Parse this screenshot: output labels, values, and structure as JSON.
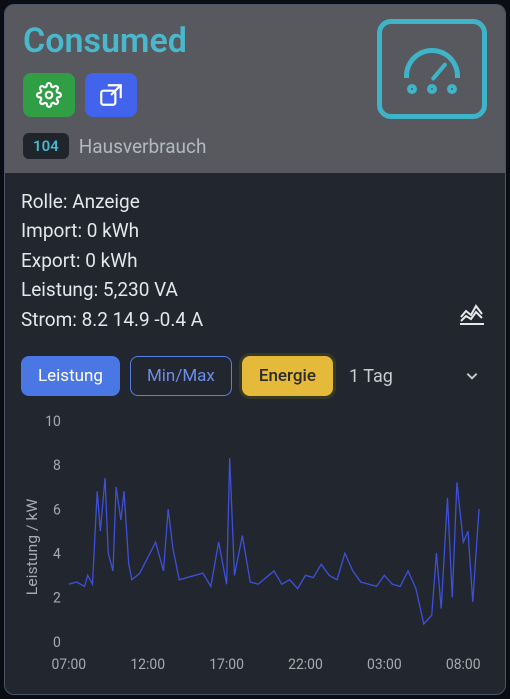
{
  "header": {
    "title": "Consumed",
    "device_id": "104",
    "device_name": "Hausverbrauch"
  },
  "info": {
    "rolle_label": "Rolle",
    "rolle_value": "Anzeige",
    "import_label": "Import",
    "import_value": "0 kWh",
    "export_label": "Export",
    "export_value": "0 kWh",
    "leistung_label": "Leistung",
    "leistung_value": "5,230 VA",
    "strom_label": "Strom",
    "strom_value": "8.2 14.9 -0.4 A"
  },
  "controls": {
    "leistung": "Leistung",
    "minmax": "Min/Max",
    "energie": "Energie",
    "range": "1 Tag"
  },
  "chart_data": {
    "type": "line",
    "title": "",
    "xlabel": "",
    "ylabel": "Leistung / kW",
    "ylim": [
      0,
      10
    ],
    "yticks": [
      0,
      2,
      4,
      6,
      8,
      10
    ],
    "xticks": [
      "07:00",
      "12:00",
      "17:00",
      "22:00",
      "03:00",
      "08:00"
    ],
    "x": [
      7.0,
      7.5,
      8.0,
      8.2,
      8.5,
      8.8,
      9.0,
      9.3,
      9.5,
      9.8,
      10.0,
      10.3,
      10.5,
      10.8,
      11.0,
      11.5,
      12.0,
      12.5,
      13.0,
      13.3,
      13.6,
      14.0,
      14.5,
      15.0,
      15.5,
      16.0,
      16.5,
      17.0,
      17.2,
      17.5,
      18.0,
      18.5,
      19.0,
      19.5,
      20.0,
      20.5,
      21.0,
      21.5,
      22.0,
      22.5,
      23.0,
      23.5,
      24.0,
      24.5,
      25.0,
      25.5,
      26.0,
      26.5,
      27.0,
      27.5,
      28.0,
      28.5,
      29.0,
      29.5,
      30.0,
      30.3,
      30.6,
      31.0,
      31.3,
      31.6,
      32.0,
      32.3,
      32.6,
      33.0
    ],
    "values": [
      2.6,
      2.7,
      2.5,
      3.0,
      2.6,
      6.8,
      5.0,
      7.4,
      4.0,
      3.2,
      7.0,
      5.5,
      6.8,
      3.5,
      2.8,
      3.1,
      3.8,
      4.5,
      3.2,
      6.0,
      4.2,
      2.8,
      2.9,
      3.0,
      3.1,
      2.5,
      4.5,
      2.6,
      8.3,
      3.0,
      4.8,
      2.7,
      2.6,
      2.9,
      3.2,
      2.6,
      2.8,
      2.4,
      3.0,
      2.9,
      3.5,
      3.0,
      2.8,
      4.0,
      3.2,
      2.7,
      2.6,
      2.5,
      3.0,
      2.6,
      2.5,
      3.2,
      2.4,
      0.8,
      1.2,
      4.0,
      1.5,
      6.5,
      2.0,
      7.2,
      4.5,
      5.0,
      1.8,
      6.0
    ]
  }
}
